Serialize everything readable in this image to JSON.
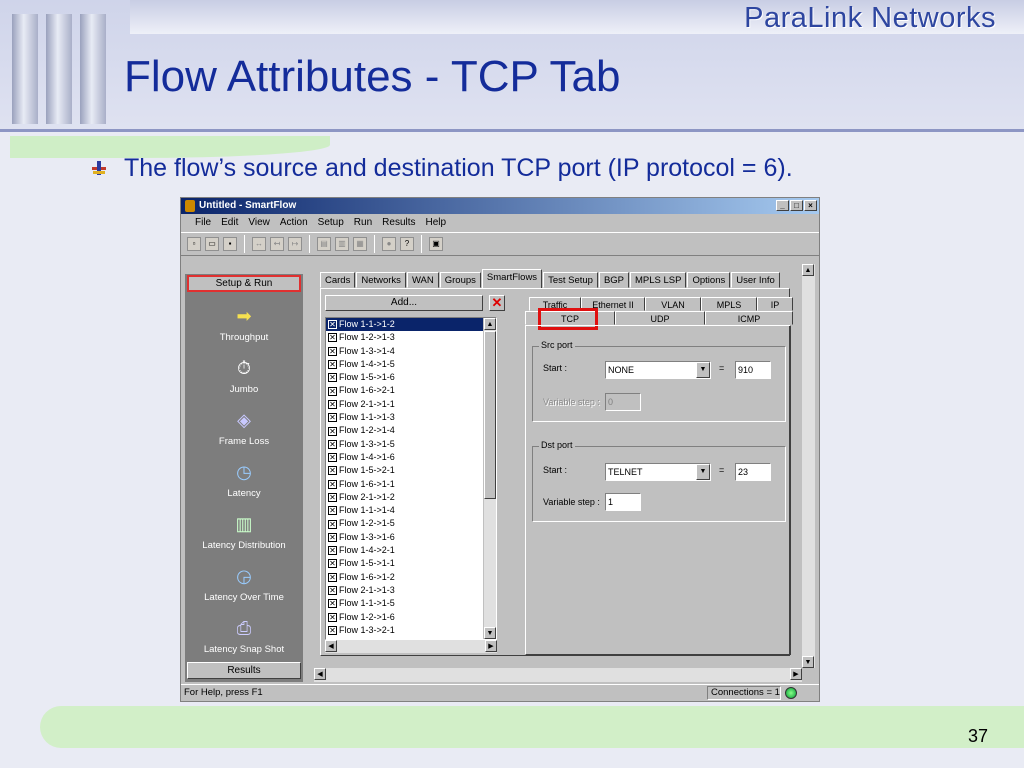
{
  "slide": {
    "brand": "ParaLink Networks",
    "title": "Flow Attributes - TCP Tab",
    "bullet": "The flow’s source and destination TCP port (IP protocol = 6).",
    "page_number": "37"
  },
  "window": {
    "title": "Untitled - SmartFlow",
    "menu": [
      "File",
      "Edit",
      "View",
      "Action",
      "Setup",
      "Run",
      "Results",
      "Help"
    ],
    "status_text": "For Help, press F1",
    "connections": "Connections = 1"
  },
  "sidebar": {
    "setup_button": "Setup & Run",
    "items": [
      "Throughput",
      "Jumbo",
      "Frame Loss",
      "Latency",
      "Latency Distribution",
      "Latency Over Time",
      "Latency Snap Shot"
    ],
    "results_button": "Results"
  },
  "tabs": [
    "Cards",
    "Networks",
    "WAN",
    "Groups",
    "SmartFlows",
    "Test Setup",
    "BGP",
    "MPLS LSP",
    "Options",
    "User Info"
  ],
  "active_tab": "SmartFlows",
  "flows": {
    "add_label": "Add...",
    "items": [
      "Flow 1-1->1-2",
      "Flow 1-2->1-3",
      "Flow 1-3->1-4",
      "Flow 1-4->1-5",
      "Flow 1-5->1-6",
      "Flow 1-6->2-1",
      "Flow 2-1->1-1",
      "Flow 1-1->1-3",
      "Flow 1-2->1-4",
      "Flow 1-3->1-5",
      "Flow 1-4->1-6",
      "Flow 1-5->2-1",
      "Flow 1-6->1-1",
      "Flow 2-1->1-2",
      "Flow 1-1->1-4",
      "Flow 1-2->1-5",
      "Flow 1-3->1-6",
      "Flow 1-4->2-1",
      "Flow 1-5->1-1",
      "Flow 1-6->1-2",
      "Flow 2-1->1-3",
      "Flow 1-1->1-5",
      "Flow 1-2->1-6",
      "Flow 1-3->2-1"
    ]
  },
  "subtabs": {
    "row1": [
      "Traffic",
      "Ethernet II",
      "VLAN",
      "MPLS",
      "IP"
    ],
    "row2": [
      "TCP",
      "UDP",
      "ICMP"
    ]
  },
  "tcp": {
    "src_group": "Src port",
    "src_start_label": "Start :",
    "src_start_select": "NONE",
    "src_equals": "=",
    "src_value": "910",
    "src_variable_label": "Variable step :",
    "src_variable_value": "0",
    "dst_group": "Dst port",
    "dst_start_label": "Start :",
    "dst_start_select": "TELNET",
    "dst_equals": "=",
    "dst_value": "23",
    "dst_variable_label": "Variable step :",
    "dst_variable_value": "1"
  },
  "colors": {
    "title": "#142c9a",
    "highlight": "#e01010",
    "titlebar": "#0a246a"
  }
}
